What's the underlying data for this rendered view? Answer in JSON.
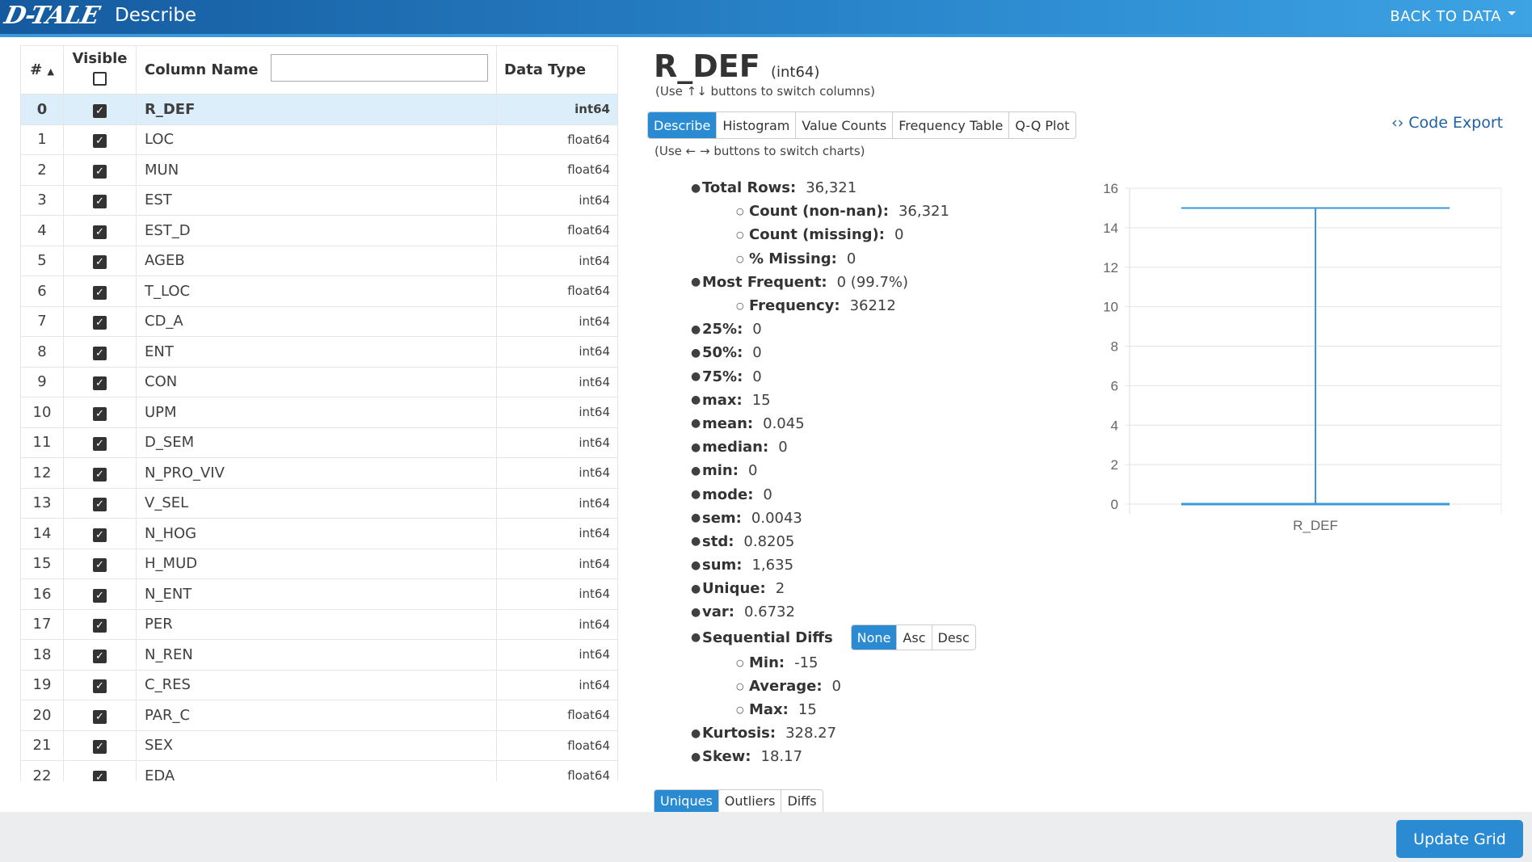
{
  "header": {
    "logo": "D-TALE",
    "title": "Describe",
    "back": "BACK TO DATA"
  },
  "table": {
    "headers": {
      "num": "#",
      "visible": "Visible",
      "name": "Column Name",
      "dtype": "Data Type"
    },
    "rows": [
      [
        "0",
        "R_DEF",
        "int64"
      ],
      [
        "1",
        "LOC",
        "float64"
      ],
      [
        "2",
        "MUN",
        "float64"
      ],
      [
        "3",
        "EST",
        "int64"
      ],
      [
        "4",
        "EST_D",
        "float64"
      ],
      [
        "5",
        "AGEB",
        "int64"
      ],
      [
        "6",
        "T_LOC",
        "float64"
      ],
      [
        "7",
        "CD_A",
        "int64"
      ],
      [
        "8",
        "ENT",
        "int64"
      ],
      [
        "9",
        "CON",
        "int64"
      ],
      [
        "10",
        "UPM",
        "int64"
      ],
      [
        "11",
        "D_SEM",
        "int64"
      ],
      [
        "12",
        "N_PRO_VIV",
        "int64"
      ],
      [
        "13",
        "V_SEL",
        "int64"
      ],
      [
        "14",
        "N_HOG",
        "int64"
      ],
      [
        "15",
        "H_MUD",
        "int64"
      ],
      [
        "16",
        "N_ENT",
        "int64"
      ],
      [
        "17",
        "PER",
        "int64"
      ],
      [
        "18",
        "N_REN",
        "int64"
      ],
      [
        "19",
        "C_RES",
        "int64"
      ],
      [
        "20",
        "PAR_C",
        "float64"
      ],
      [
        "21",
        "SEX",
        "float64"
      ],
      [
        "22",
        "EDA",
        "float64"
      ]
    ]
  },
  "detail": {
    "name": "R_DEF",
    "dtype": "(int64)",
    "hint_cols": "(Use ↑↓ buttons to switch columns)",
    "hint_charts": "(Use ← → buttons to switch charts)",
    "tabs": [
      "Describe",
      "Histogram",
      "Value Counts",
      "Frequency Table",
      "Q-Q Plot"
    ],
    "code_export": "Code Export",
    "stats": [
      [
        "Total Rows:",
        "36,321",
        0
      ],
      [
        "Count (non-nan):",
        "36,321",
        1
      ],
      [
        "Count (missing):",
        "0",
        1
      ],
      [
        "% Missing:",
        "0",
        1
      ],
      [
        "Most Frequent:",
        "0 (99.7%)",
        0
      ],
      [
        "Frequency:",
        "36212",
        1
      ],
      [
        "25%:",
        "0",
        0
      ],
      [
        "50%:",
        "0",
        0
      ],
      [
        "75%:",
        "0",
        0
      ],
      [
        "max:",
        "15",
        0
      ],
      [
        "mean:",
        "0.045",
        0
      ],
      [
        "median:",
        "0",
        0
      ],
      [
        "min:",
        "0",
        0
      ],
      [
        "mode:",
        "0",
        0
      ],
      [
        "sem:",
        "0.0043",
        0
      ],
      [
        "std:",
        "0.8205",
        0
      ],
      [
        "sum:",
        "1,635",
        0
      ],
      [
        "Unique:",
        "2",
        0
      ],
      [
        "var:",
        "0.6732",
        0
      ]
    ],
    "seq_label": "Sequential Diffs",
    "seq_buttons": [
      "None",
      "Asc",
      "Desc"
    ],
    "seq_stats": [
      [
        "Min:",
        "-15",
        1
      ],
      [
        "Average:",
        "0",
        1
      ],
      [
        "Max:",
        "15",
        1
      ],
      [
        "Kurtosis:",
        "328.27",
        0
      ],
      [
        "Skew:",
        "18.17",
        0
      ]
    ],
    "bottom_tabs": [
      "Uniques",
      "Outliers",
      "Diffs"
    ]
  },
  "chart_data": {
    "type": "box",
    "categories": [
      "R_DEF"
    ],
    "min": 0,
    "q1": 0,
    "median": 0,
    "q3": 0,
    "max": 15,
    "ylim": [
      0,
      16
    ],
    "yticks": [
      0,
      2,
      4,
      6,
      8,
      10,
      12,
      14,
      16
    ],
    "grid": true,
    "color": "#3a9ad9"
  },
  "footer": {
    "update": "Update Grid"
  }
}
